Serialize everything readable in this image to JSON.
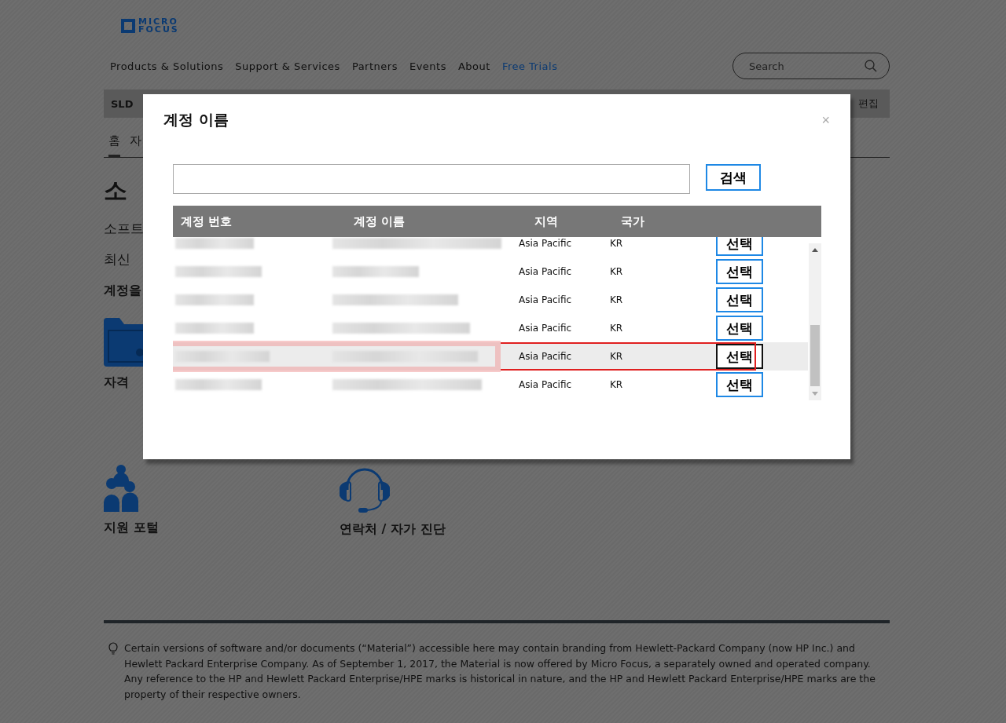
{
  "logo": {
    "line_1": "MICRO",
    "line_2": "FOCUS"
  },
  "nav": [
    {
      "label": "Products & Solutions",
      "highlighted": false
    },
    {
      "label": "Support & Services",
      "highlighted": false
    },
    {
      "label": "Partners",
      "highlighted": false
    },
    {
      "label": "Events",
      "highlighted": false
    },
    {
      "label": "About",
      "highlighted": false
    },
    {
      "label": "Free Trials",
      "highlighted": true
    }
  ],
  "search": {
    "placeholder": "Search"
  },
  "subbar": {
    "title": "SLD",
    "action": "편집"
  },
  "tabs": [
    {
      "label": "홈",
      "selected": true
    },
    {
      "label": "자",
      "selected": false
    }
  ],
  "page": {
    "heading": "소",
    "intro": "소프트",
    "line_2": "최신",
    "section_title": "계정을"
  },
  "tiles": [
    {
      "label": "자격",
      "kind": "folder"
    },
    {
      "label": "지원 포털",
      "kind": "people"
    },
    {
      "label": "연락처 / 자가 진단",
      "kind": "headset"
    }
  ],
  "modal": {
    "title": "계정 이름",
    "close": "×",
    "search_button": "검색",
    "columns": [
      "계정 번호",
      "계정 이름",
      "지역",
      "국가"
    ],
    "rows": [
      {
        "blurred": true,
        "region": "Asia Pacific",
        "country": "KR",
        "action": "선택",
        "selected": false
      },
      {
        "blurred": true,
        "region": "Asia Pacific",
        "country": "KR",
        "action": "선택",
        "selected": false
      },
      {
        "blurred": true,
        "region": "Asia Pacific",
        "country": "KR",
        "action": "선택",
        "selected": false
      },
      {
        "blurred": true,
        "region": "Asia Pacific",
        "country": "KR",
        "action": "선택",
        "selected": false
      },
      {
        "blurred": true,
        "region": "Asia Pacific",
        "country": "KR",
        "action": "선택",
        "selected": true
      },
      {
        "blurred": true,
        "region": "Asia Pacific",
        "country": "KR",
        "action": "선택",
        "selected": false
      }
    ]
  },
  "footer": {
    "notice": "Certain versions of software and/or documents (“Material”) accessible here may contain branding from Hewlett-Packard Company (now HP Inc.) and Hewlett Packard Enterprise Company. As of September 1, 2017, the Material is now offered by Micro Focus, a separately owned and operated company. Any reference to the HP and Hewlett Packard Enterprise/HPE marks is historical in nature, and the HP and Hewlett Packard Enterprise/HPE marks are the property of their respective owners."
  }
}
